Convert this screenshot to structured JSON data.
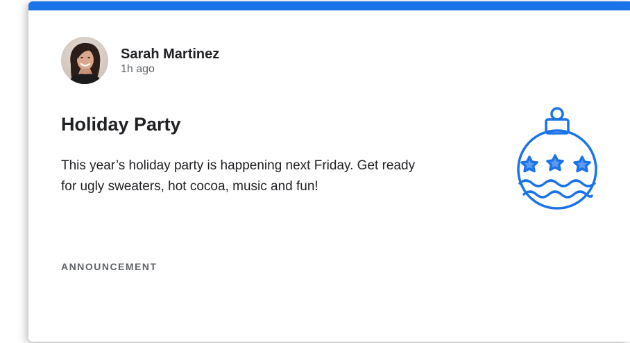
{
  "post": {
    "author_name": "Sarah Martinez",
    "timestamp": "1h ago",
    "title": "Holiday Party",
    "body": "This year’s holiday party is happening next Friday. Get ready for ugly sweaters, hot cocoa, music and fun!",
    "category": "ANNOUNCEMENT",
    "illustration_icon": "christmas-ornament-icon"
  },
  "colors": {
    "accent": "#1a73e8",
    "text_primary": "#202124",
    "text_secondary": "#5f6368"
  }
}
